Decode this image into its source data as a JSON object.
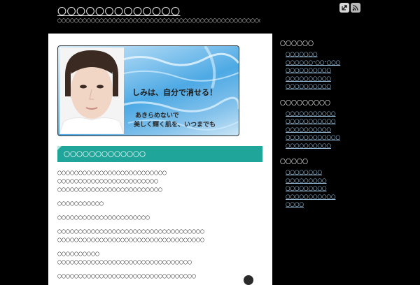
{
  "header": {
    "site_title": "〇〇〇〇〇〇〇〇〇〇〇〇〇",
    "tagline": "〇〇〇〇〇〇〇〇〇〇〇〇〇〇〇〇〇〇〇〇〇〇〇〇〇〇〇〇〇〇〇〇〇〇〇〇〇〇〇〇〇〇〇〇〇〇〇〇〇〇〇〇〇〇〇〇〇〇〇〇〇〇〇〇〇〇",
    "icons": [
      "home-bookmark-icon",
      "rss-icon"
    ]
  },
  "banner": {
    "headline": "しみは、自分で消せる！",
    "sub_line_1": "あきらめないで",
    "sub_line_2": "美しく輝く肌を、いつまでも"
  },
  "post": {
    "title": "〇〇〇〇〇〇〇〇〇〇〇〇〇",
    "paragraphs": [
      "〇〇〇〇〇〇〇〇〇〇〇〇〇〇〇〇〇〇〇〇〇〇〇〇〇〇",
      "〇〇〇〇〇〇〇〇〇〇〇〇〇〇〇〇〇〇〇〇〇〇〇〇",
      "〇〇〇〇〇〇〇〇〇〇〇〇〇〇〇〇〇〇〇〇〇〇〇〇〇",
      "〇〇〇〇〇〇〇〇〇〇〇",
      "〇〇〇〇〇〇〇〇〇〇〇〇〇〇〇〇〇〇〇〇〇〇",
      "〇〇〇〇〇〇〇〇〇〇〇〇〇〇〇〇〇〇〇〇〇〇〇〇〇〇〇〇〇〇〇〇〇〇〇",
      "〇〇〇〇〇〇〇〇〇〇〇〇〇〇〇〇〇〇〇〇〇〇〇〇〇〇〇〇〇〇〇〇〇〇〇",
      "〇〇〇〇〇〇〇〇〇〇",
      "〇〇〇〇〇〇〇〇〇〇〇〇〇〇〇〇〇〇〇〇〇〇〇〇〇〇〇〇〇〇〇〇",
      "〇〇〇〇〇〇〇〇〇〇〇〇〇〇〇〇〇〇〇〇〇〇〇〇〇〇〇〇〇〇〇〇〇"
    ]
  },
  "sidebar": {
    "widgets": [
      {
        "heading": "〇〇〇〇〇〇",
        "items": [
          "〇〇〇〇〇〇〇",
          "〇〇〇〇〇〇“〇〇”〇〇〇",
          "〇〇〇〇〇〇〇〇〇〇",
          "〇〇〇〇〇〇〇〇〇〇",
          "〇〇〇〇〇〇〇〇〇〇"
        ]
      },
      {
        "heading": "〇〇〇〇〇〇〇〇〇",
        "items": [
          "〇〇〇〇〇〇〇〇〇〇〇",
          "〇〇〇〇〇〇〇〇〇〇〇",
          "〇〇〇〇〇〇〇〇〇〇",
          "〇〇〇〇〇〇〇〇〇〇〇〇",
          "〇〇〇〇〇〇〇〇〇〇"
        ]
      },
      {
        "heading": "〇〇〇〇〇",
        "items": [
          "〇〇〇〇〇〇〇〇",
          "〇〇〇〇〇〇〇〇〇",
          "〇〇〇〇〇〇〇〇〇",
          "〇〇〇〇〇〇〇〇〇〇〇",
          "〇〇〇〇"
        ]
      }
    ]
  }
}
